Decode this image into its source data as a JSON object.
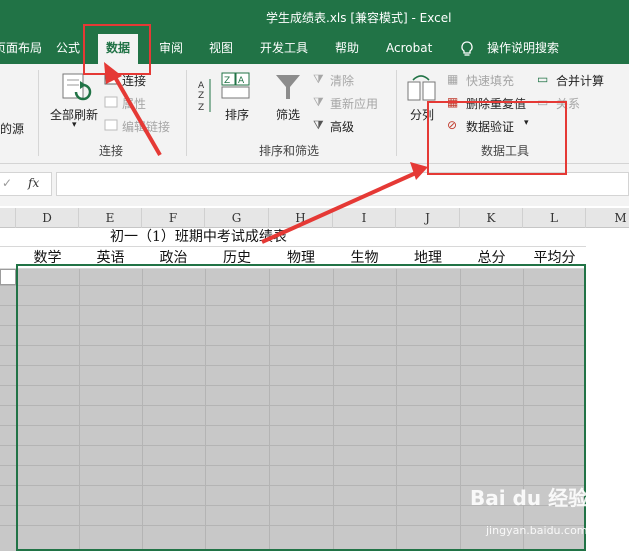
{
  "window": {
    "title": "学生成绩表.xls  [兼容模式]  -  Excel"
  },
  "tabs": [
    {
      "label": "页面布局"
    },
    {
      "label": "公式"
    },
    {
      "label": "数据"
    },
    {
      "label": "审阅"
    },
    {
      "label": "视图"
    },
    {
      "label": "开发工具"
    },
    {
      "label": "帮助"
    },
    {
      "label": "Acrobat"
    },
    {
      "label": "操作说明搜索"
    }
  ],
  "ribbon": {
    "get_data_partial": "的源",
    "refresh_all": "全部刷新",
    "connections": "连接",
    "properties": "属性",
    "edit_links": "编辑链接",
    "group_connections": "连接",
    "sort": "排序",
    "filter": "筛选",
    "clear": "清除",
    "reapply": "重新应用",
    "advanced": "高级",
    "group_sort_filter": "排序和筛选",
    "text_to_columns": "分列",
    "flash_fill": "快速填充",
    "remove_duplicates": "删除重复值",
    "data_validation": "数据验证",
    "consolidate": "合并计算",
    "relationships": "关系",
    "group_data_tools": "数据工具"
  },
  "formula_bar": {
    "fx": "fx",
    "value": ""
  },
  "sheet": {
    "columns": [
      "D",
      "E",
      "F",
      "G",
      "H",
      "I",
      "J",
      "K",
      "L",
      "M"
    ],
    "caption": "初一（1）班期中考试成绩表",
    "headers": [
      "数学",
      "英语",
      "政治",
      "历史",
      "物理",
      "生物",
      "地理",
      "总分",
      "平均分"
    ]
  },
  "watermark": {
    "brand": "Bai du 经验",
    "url": "jingyan.baidu.com"
  },
  "colors": {
    "excel_green": "#217346",
    "annotation_red": "#e53935",
    "selection_gray": "#c8c8c8"
  }
}
